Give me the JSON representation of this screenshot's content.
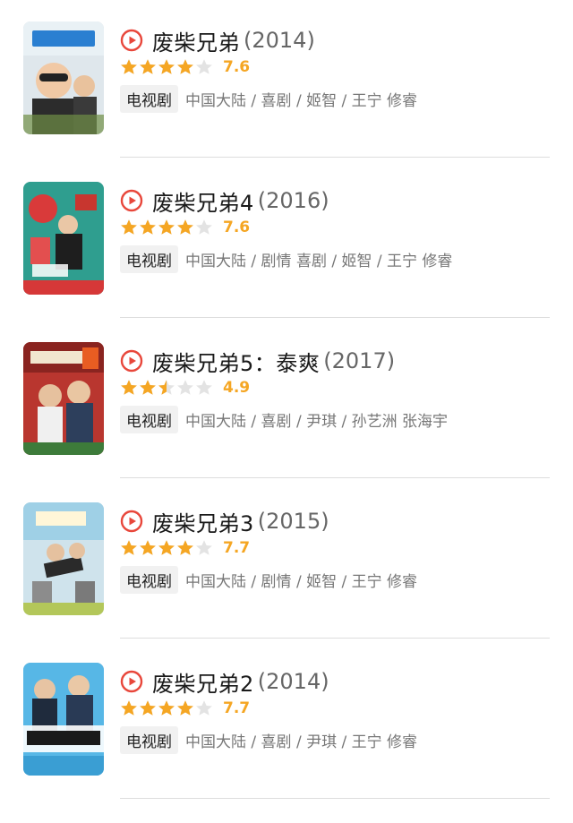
{
  "accent_color": "#e8473b",
  "star_color": "#f5a623",
  "items": [
    {
      "title": "废柴兄弟",
      "year": "(2014)",
      "rating_value": 4,
      "score": "7.6",
      "type": "电视剧",
      "meta": "中国大陆 / 喜剧 / 姬智 / 王宁 修睿",
      "icon": "play-circle-icon"
    },
    {
      "title": "废柴兄弟4",
      "year": "(2016)",
      "rating_value": 4,
      "score": "7.6",
      "type": "电视剧",
      "meta": "中国大陆 / 剧情 喜剧 / 姬智 / 王宁 修睿",
      "icon": "play-circle-icon"
    },
    {
      "title": "废柴兄弟5：泰爽",
      "year": "(2017)",
      "rating_value": 2.5,
      "score": "4.9",
      "type": "电视剧",
      "meta": "中国大陆 / 喜剧 / 尹琪 / 孙艺洲 张海宇",
      "icon": "play-circle-icon"
    },
    {
      "title": "废柴兄弟3",
      "year": "(2015)",
      "rating_value": 4,
      "score": "7.7",
      "type": "电视剧",
      "meta": "中国大陆 / 剧情 / 姬智 / 王宁 修睿",
      "icon": "play-circle-icon"
    },
    {
      "title": "废柴兄弟2",
      "year": "(2014)",
      "rating_value": 4,
      "score": "7.7",
      "type": "电视剧",
      "meta": "中国大陆 / 喜剧 / 尹琪 / 王宁 修睿",
      "icon": "play-circle-icon"
    }
  ]
}
